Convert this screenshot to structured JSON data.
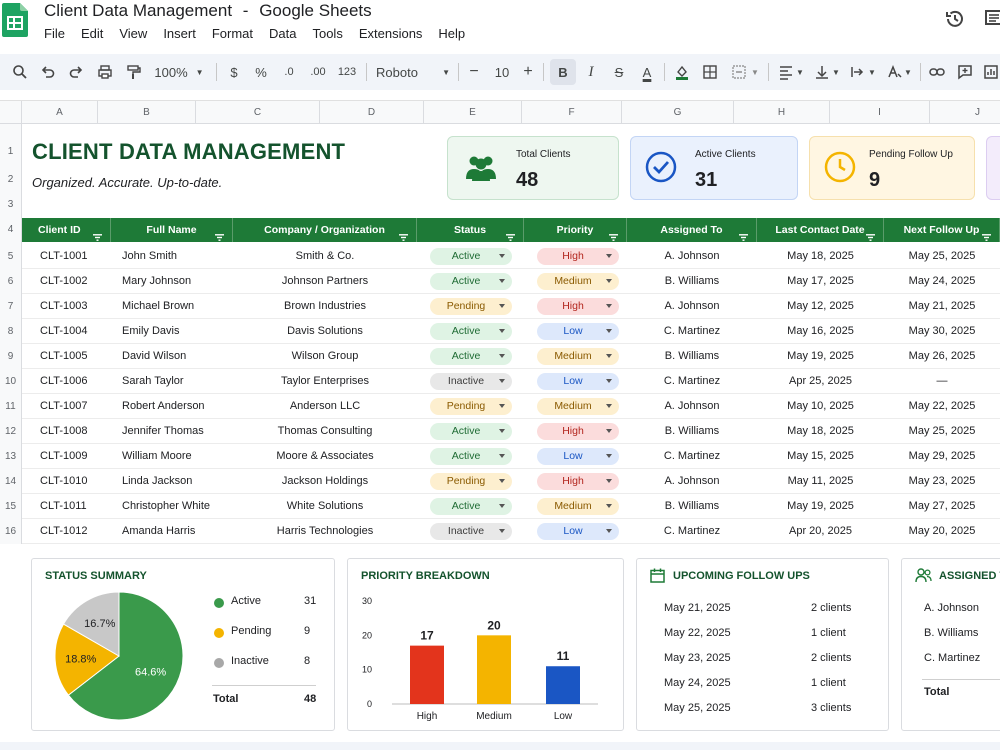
{
  "app": {
    "doc_title": "Client Data Management",
    "separator": "-",
    "app_name": "Google Sheets",
    "menu": [
      "File",
      "Edit",
      "View",
      "Insert",
      "Format",
      "Data",
      "Tools",
      "Extensions",
      "Help"
    ]
  },
  "toolbar": {
    "zoom": "100%",
    "currency": "$",
    "percent": "%",
    "dec_decrease": ".0",
    "dec_increase": ".00",
    "number_format": "123",
    "font": "Roboto",
    "font_size": "10",
    "minus": "−",
    "plus": "+",
    "bold": "B",
    "italic": "I",
    "strike": "S",
    "text_color": "A"
  },
  "grid": {
    "columns": [
      "A",
      "B",
      "C",
      "D",
      "E",
      "F",
      "G",
      "H",
      "I",
      "J"
    ],
    "rows": [
      "1",
      "2",
      "3",
      "4",
      "5",
      "6",
      "7",
      "8",
      "9",
      "10",
      "11",
      "12",
      "13",
      "14",
      "15",
      "16"
    ]
  },
  "header": {
    "title": "CLIENT DATA MANAGEMENT",
    "subtitle": "Organized. Accurate. Up-to-date."
  },
  "kpis": [
    {
      "label": "Total Clients",
      "value": "48",
      "icon": "users-icon",
      "color": "#1e7a37"
    },
    {
      "label": "Active Clients",
      "value": "31",
      "icon": "check-circle-icon",
      "color": "#1a56c4"
    },
    {
      "label": "Pending Follow Up",
      "value": "9",
      "icon": "clock-icon",
      "color": "#f4b400"
    }
  ],
  "table": {
    "columns": [
      "Client ID",
      "Full Name",
      "Company / Organization",
      "Status",
      "Priority",
      "Assigned To",
      "Last Contact Date",
      "Next Follow Up"
    ],
    "rows": [
      [
        "CLT-1001",
        "John Smith",
        "Smith & Co.",
        "Active",
        "High",
        "A. Johnson",
        "May 18, 2025",
        "May 25, 2025"
      ],
      [
        "CLT-1002",
        "Mary Johnson",
        "Johnson Partners",
        "Active",
        "Medium",
        "B. Williams",
        "May 17, 2025",
        "May 24, 2025"
      ],
      [
        "CLT-1003",
        "Michael Brown",
        "Brown Industries",
        "Pending",
        "High",
        "A. Johnson",
        "May 12, 2025",
        "May 21, 2025"
      ],
      [
        "CLT-1004",
        "Emily Davis",
        "Davis Solutions",
        "Active",
        "Low",
        "C. Martinez",
        "May 16, 2025",
        "May 30, 2025"
      ],
      [
        "CLT-1005",
        "David Wilson",
        "Wilson Group",
        "Active",
        "Medium",
        "B. Williams",
        "May 19, 2025",
        "May 26, 2025"
      ],
      [
        "CLT-1006",
        "Sarah Taylor",
        "Taylor Enterprises",
        "Inactive",
        "Low",
        "C. Martinez",
        "Apr 25, 2025",
        "—"
      ],
      [
        "CLT-1007",
        "Robert Anderson",
        "Anderson LLC",
        "Pending",
        "Medium",
        "A. Johnson",
        "May 10, 2025",
        "May 22, 2025"
      ],
      [
        "CLT-1008",
        "Jennifer Thomas",
        "Thomas Consulting",
        "Active",
        "High",
        "B. Williams",
        "May 18, 2025",
        "May 25, 2025"
      ],
      [
        "CLT-1009",
        "William Moore",
        "Moore & Associates",
        "Active",
        "Low",
        "C. Martinez",
        "May 15, 2025",
        "May 29, 2025"
      ],
      [
        "CLT-1010",
        "Linda Jackson",
        "Jackson Holdings",
        "Pending",
        "High",
        "A. Johnson",
        "May 11, 2025",
        "May 23, 2025"
      ],
      [
        "CLT-1011",
        "Christopher White",
        "White Solutions",
        "Active",
        "Medium",
        "B. Williams",
        "May 19, 2025",
        "May 27, 2025"
      ],
      [
        "CLT-1012",
        "Amanda Harris",
        "Harris Technologies",
        "Inactive",
        "Low",
        "C. Martinez",
        "Apr 20, 2025",
        "May 20, 2025"
      ]
    ]
  },
  "pill_colors": {
    "Active": {
      "bg": "#dff3e4",
      "fg": "#1e6b33"
    },
    "Pending": {
      "bg": "#fdefcf",
      "fg": "#8a5a00"
    },
    "Inactive": {
      "bg": "#e8e8e8",
      "fg": "#3c3c3c"
    },
    "High": {
      "bg": "#fbdcdc",
      "fg": "#b3261e"
    },
    "Medium": {
      "bg": "#fdefcf",
      "fg": "#8a5a00"
    },
    "Low": {
      "bg": "#dde8fb",
      "fg": "#1a56c4"
    }
  },
  "status_summary": {
    "title": "STATUS SUMMARY",
    "items": [
      {
        "label": "Active",
        "value": "31",
        "color": "#3a9a4b"
      },
      {
        "label": "Pending",
        "value": "9",
        "color": "#f4b400"
      },
      {
        "label": "Inactive",
        "value": "8",
        "color": "#a8a8a8"
      }
    ],
    "total_label": "Total",
    "total_value": "48"
  },
  "priority_breakdown": {
    "title": "PRIORITY BREAKDOWN"
  },
  "follow_ups": {
    "title": "UPCOMING FOLLOW UPS",
    "items": [
      {
        "date": "May 21, 2025",
        "count": "2 clients"
      },
      {
        "date": "May 22, 2025",
        "count": "1 client"
      },
      {
        "date": "May 23, 2025",
        "count": "2 clients"
      },
      {
        "date": "May 24, 2025",
        "count": "1 client"
      },
      {
        "date": "May 25, 2025",
        "count": "3 clients"
      }
    ]
  },
  "assigned": {
    "title": "ASSIGNED T",
    "items": [
      "A. Johnson",
      "B. Williams",
      "C. Martinez"
    ],
    "total_label": "Total"
  },
  "chart_data": [
    {
      "type": "pie",
      "title": "STATUS SUMMARY",
      "categories": [
        "Active",
        "Pending",
        "Inactive"
      ],
      "values": [
        64.6,
        18.8,
        16.7
      ],
      "labels": [
        "64.6%",
        "18.8%",
        "16.7%"
      ],
      "colors": [
        "#3a9a4b",
        "#f4b400",
        "#c8c8c8"
      ]
    },
    {
      "type": "bar",
      "title": "PRIORITY BREAKDOWN",
      "categories": [
        "High",
        "Medium",
        "Low"
      ],
      "values": [
        17,
        20,
        11
      ],
      "colors": [
        "#e3341c",
        "#f4b400",
        "#1a56c4"
      ],
      "ylim": [
        0,
        30
      ],
      "yticks": [
        0,
        10,
        20,
        30
      ],
      "grid": false
    }
  ]
}
